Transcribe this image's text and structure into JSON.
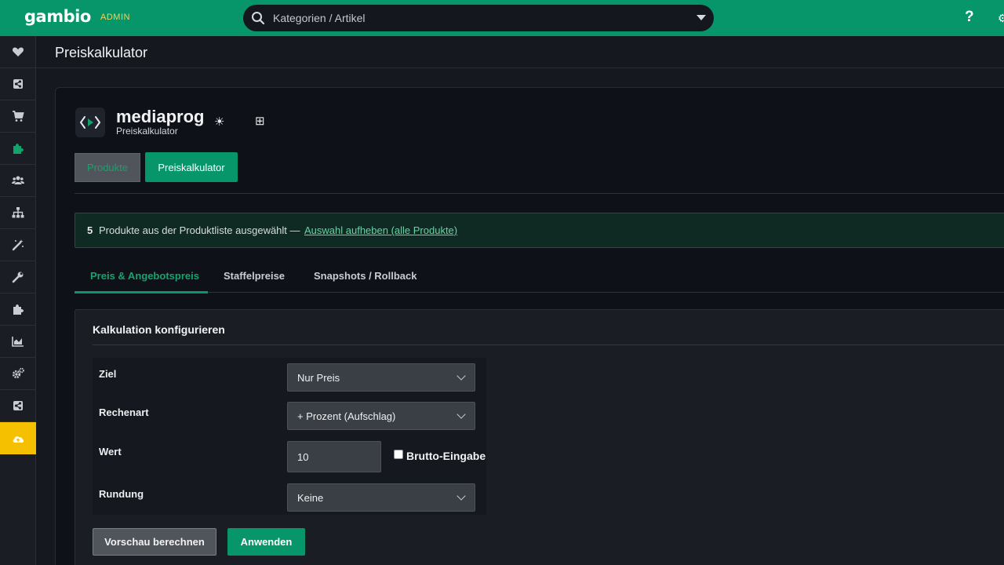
{
  "topbar": {
    "logo": "gambio",
    "logo_badge": "ADMIN",
    "search_placeholder": "Kategorien / Artikel",
    "help_label": "?"
  },
  "sidebar": {
    "items": [
      {
        "icon": "heart-icon"
      },
      {
        "icon": "share-icon"
      },
      {
        "icon": "cart-icon"
      },
      {
        "icon": "puzzle-icon",
        "active": true
      },
      {
        "icon": "users-icon"
      },
      {
        "icon": "sitemap-icon"
      },
      {
        "icon": "magic-wand-icon"
      },
      {
        "icon": "wrench-icon"
      },
      {
        "icon": "puzzle-icon"
      },
      {
        "icon": "chart-icon"
      },
      {
        "icon": "cogs-icon"
      },
      {
        "icon": "share-icon"
      },
      {
        "icon": "cloud-upload-icon",
        "highlight": "#f5c000"
      }
    ]
  },
  "page": {
    "title": "Preiskalkulator"
  },
  "app": {
    "name": "mediaprog",
    "subtitle": "Preiskalkulator",
    "theme_icon": "☀",
    "grid_icon": "⊞"
  },
  "nav_buttons": {
    "produkte": "Produkte",
    "preiskalkulator": "Preiskalkulator"
  },
  "info": {
    "count": "5",
    "text": "Produkte aus der Produktliste ausgewählt —",
    "link": "Auswahl aufheben (alle Produkte)"
  },
  "tabs": [
    {
      "label": "Preis & Angebotspreis",
      "active": true
    },
    {
      "label": "Staffelpreise",
      "active": false
    },
    {
      "label": "Snapshots / Rollback",
      "active": false
    }
  ],
  "panel": {
    "title": "Kalkulation konfigurieren",
    "fields": {
      "ziel": {
        "label": "Ziel",
        "value": "Nur Preis"
      },
      "rechenart": {
        "label": "Rechenart",
        "value": "+ Prozent (Aufschlag)"
      },
      "wert": {
        "label": "Wert",
        "value": "10",
        "checkbox_label": "Brutto-Eingabe"
      },
      "rundung": {
        "label": "Rundung",
        "value": "Keine"
      }
    },
    "buttons": {
      "preview": "Vorschau berechnen",
      "apply": "Anwenden"
    }
  },
  "colors": {
    "brand": "#079669",
    "accent_text": "#16a36e",
    "highlight": "#f5c000",
    "background": "#15181f"
  }
}
